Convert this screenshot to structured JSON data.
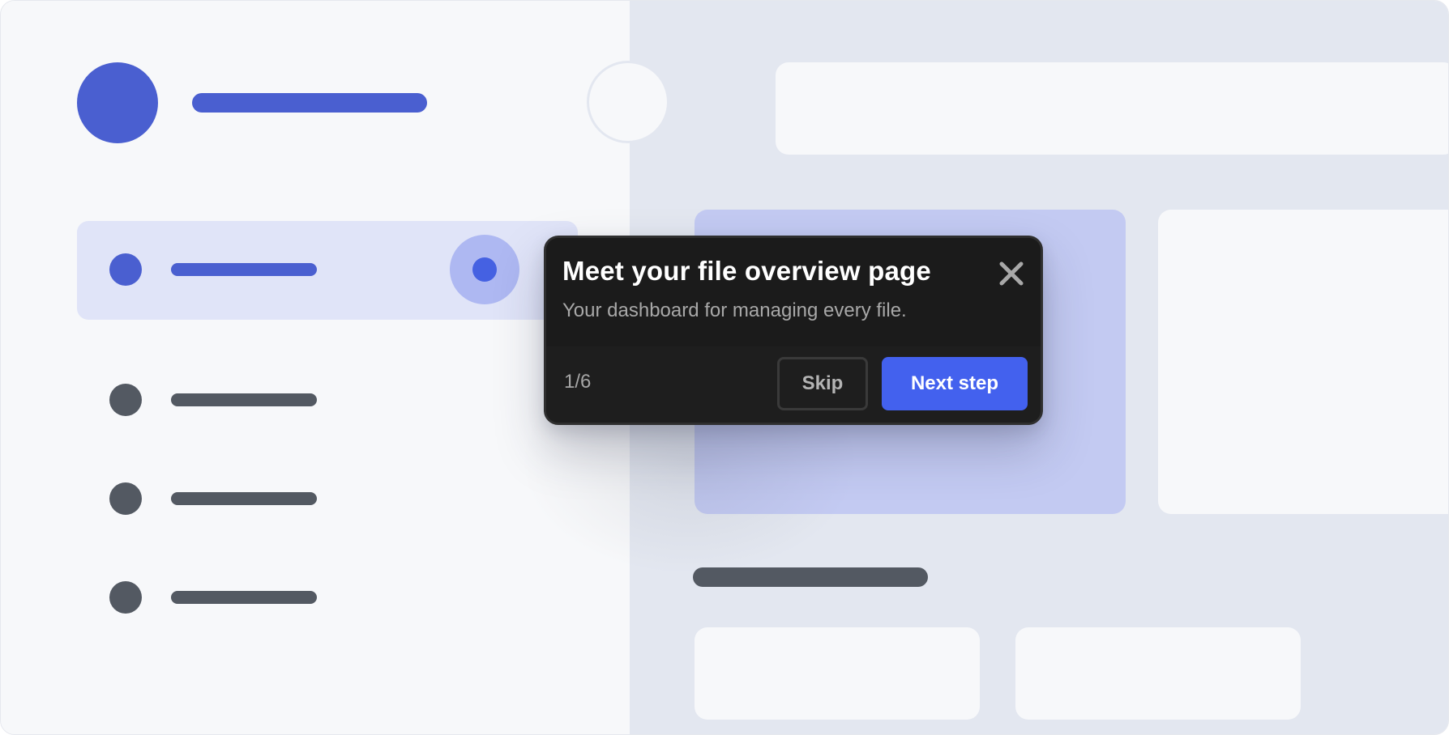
{
  "colors": {
    "accent": "#4361ee",
    "brand": "#4a5fd0",
    "tooltip_bg": "#1b1b1b",
    "highlight_card": "#c3caf2",
    "sidebar_bg": "#f7f8fa",
    "content_bg": "#e3e7f0"
  },
  "icons": {
    "close": "close-icon"
  },
  "tour": {
    "title": "Meet your file overview page",
    "subtitle": "Your dashboard for managing every file.",
    "step_counter": "1/6",
    "skip_label": "Skip",
    "next_label": "Next step"
  }
}
